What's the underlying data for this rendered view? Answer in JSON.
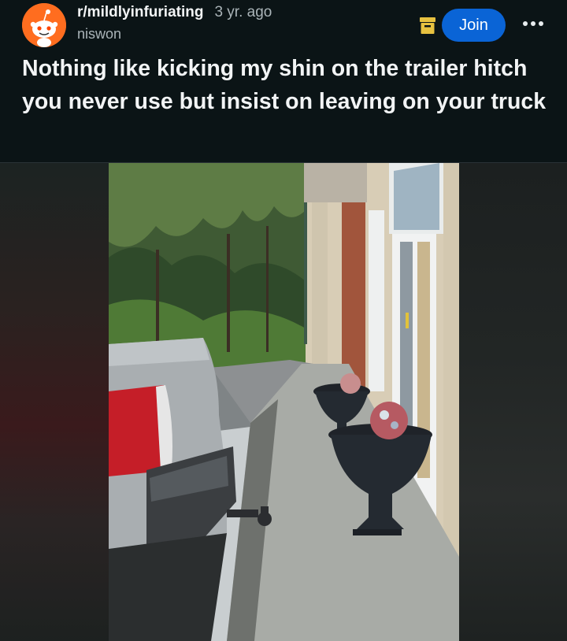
{
  "post": {
    "subreddit": "r/mildlyinfuriating",
    "age": "3 yr. ago",
    "author": "niswon",
    "join_label": "Join",
    "title": "Nothing like kicking my shin on the trailer hitch you never use but insist on leaving on your truck"
  },
  "icons": {
    "avatar": "reddit-snoo-avatar-icon",
    "archive": "archive-box-icon",
    "more": "more-options-icon"
  },
  "colors": {
    "background": "#0b1416",
    "join_button": "#0a64d6",
    "avatar_orange": "#ff6d1f",
    "muted_text": "#aab4b8"
  },
  "media": {
    "description_visible": false
  }
}
